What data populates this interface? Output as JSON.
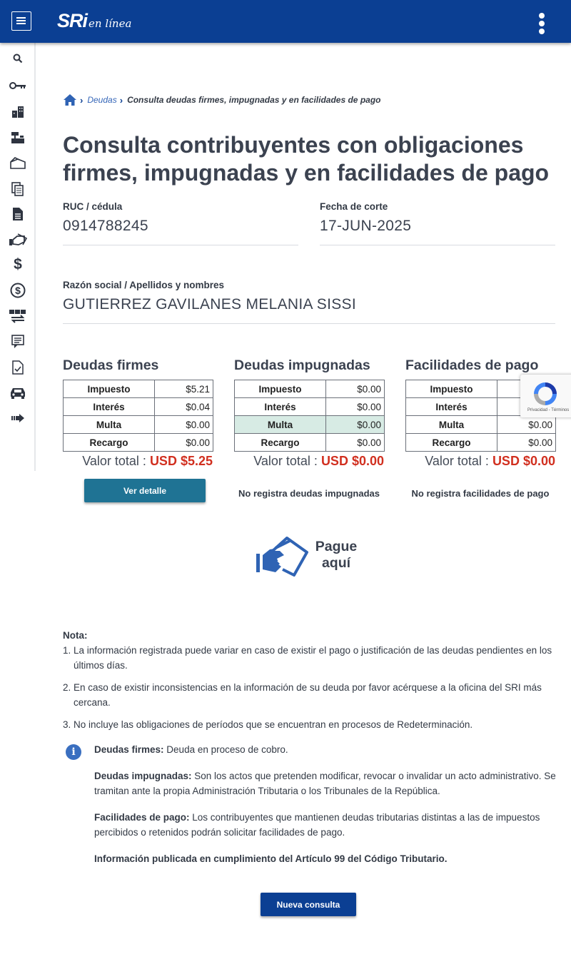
{
  "header": {
    "logo_main": "SRi",
    "logo_sub": "en línea"
  },
  "sidebar": {
    "items": [
      {
        "icon": "search-icon"
      },
      {
        "icon": "key-icon"
      },
      {
        "icon": "buildings-icon"
      },
      {
        "icon": "cash-register-icon"
      },
      {
        "icon": "open-box-icon"
      },
      {
        "icon": "documents-icon"
      },
      {
        "icon": "document-icon"
      },
      {
        "icon": "hand-card-icon"
      },
      {
        "icon": "dollar-icon"
      },
      {
        "icon": "dollar-circle-icon"
      },
      {
        "icon": "exchange-icon"
      },
      {
        "icon": "notes-icon"
      },
      {
        "icon": "checklist-icon"
      },
      {
        "icon": "car-icon"
      },
      {
        "icon": "arrow-right-icon"
      }
    ]
  },
  "breadcrumb": {
    "link": "Deudas",
    "current": "Consulta deudas firmes, impugnadas y en facilidades de pago"
  },
  "page_title": "Consulta contribuyentes con obligaciones firmes, impugnadas y en facilidades de pago",
  "fields": {
    "ruc_label": "RUC / cédula",
    "ruc_value": "0914788245",
    "fecha_label": "Fecha de corte",
    "fecha_value": "17-JUN-2025",
    "razon_label": "Razón social / Apellidos y nombres",
    "razon_value": "GUTIERREZ GAVILANES MELANIA SISSI"
  },
  "cards": [
    {
      "title": "Deudas firmes",
      "rows": [
        {
          "k": "Impuesto",
          "v": "$5.21"
        },
        {
          "k": "Interés",
          "v": "$0.04"
        },
        {
          "k": "Multa",
          "v": "$0.00"
        },
        {
          "k": "Recargo",
          "v": "$0.00"
        }
      ],
      "total_label": "Valor total : ",
      "total_amount": "USD $5.25",
      "button": "Ver detalle"
    },
    {
      "title": "Deudas impugnadas",
      "rows": [
        {
          "k": "Impuesto",
          "v": "$0.00"
        },
        {
          "k": "Interés",
          "v": "$0.00"
        },
        {
          "k": "Multa",
          "v": "$0.00"
        },
        {
          "k": "Recargo",
          "v": "$0.00"
        }
      ],
      "total_label": "Valor total : ",
      "total_amount": "USD $0.00",
      "note": "No registra deudas impugnadas"
    },
    {
      "title": "Facilidades de pago",
      "rows": [
        {
          "k": "Impuesto",
          "v": "$0.00"
        },
        {
          "k": "Interés",
          "v": "$0.00"
        },
        {
          "k": "Multa",
          "v": "$0.00"
        },
        {
          "k": "Recargo",
          "v": "$0.00"
        }
      ],
      "total_label": "Valor total : ",
      "total_amount": "USD $0.00",
      "note": "No registra facilidades de pago"
    }
  ],
  "recaptcha": {
    "text": "Privacidad - Términos"
  },
  "pay": {
    "line1": "Pague",
    "line2": "aquí"
  },
  "notes": {
    "title": "Nota:",
    "items": [
      {
        "num": "1.",
        "text": "La información registrada puede variar en caso de existir el pago o justificación de las deudas pendientes en los últimos días."
      },
      {
        "num": "2.",
        "text": "En caso de existir inconsistencias en la información de su deuda por favor acérquese a la oficina del SRI más cercana."
      },
      {
        "num": "3.",
        "text": "No incluye las obligaciones de períodos que se encuentran en procesos de Redeterminación."
      }
    ]
  },
  "info": {
    "icon": "i",
    "firmes_label": "Deudas firmes:",
    "firmes_text": " Deuda en proceso de cobro.",
    "impugnadas_label": "Deudas impugnadas:",
    "impugnadas_text": " Son los actos que pretenden modificar, revocar o invalidar un acto administrativo. Se tramitan ante la propia Administración Tributaria o los Tribunales de la República.",
    "facilidades_label": "Facilidades de pago:",
    "facilidades_text": " Los contribuyentes que mantienen deudas tributarias distintas a las de impuestos percibidos o retenidos podrán solicitar facilidades de pago.",
    "publicada": "Información publicada en cumplimiento del Artículo 99 del Código Tributario."
  },
  "nueva_consulta": "Nueva consulta",
  "colors": {
    "header": "#0b3f93",
    "accent_button": "#1f7394",
    "total_red": "#d12f1f",
    "highlight_row": "#d7ebe4"
  }
}
